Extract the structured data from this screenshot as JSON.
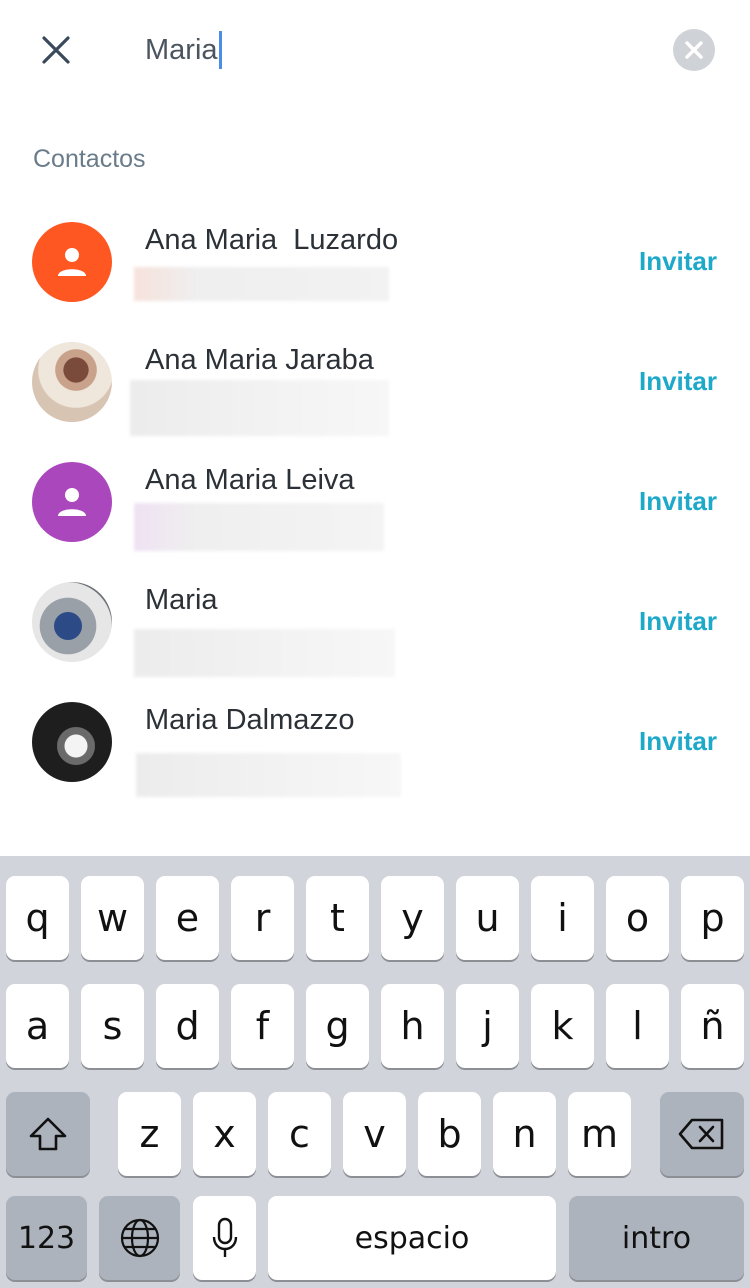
{
  "search": {
    "query": "Maria",
    "close_icon": "close-icon",
    "clear_icon": "clear-circle-icon"
  },
  "section_title": "Contactos",
  "contacts": [
    {
      "name": "Ana Maria  Luzardo",
      "avatar": "person-placeholder",
      "avatar_color": "#ff5722",
      "action": "Invitar"
    },
    {
      "name": "Ana Maria Jaraba",
      "avatar": "photo",
      "action": "Invitar"
    },
    {
      "name": "Ana Maria Leiva",
      "avatar": "person-placeholder",
      "avatar_color": "#ab47bc",
      "action": "Invitar"
    },
    {
      "name": "Maria",
      "avatar": "photo",
      "action": "Invitar"
    },
    {
      "name": "Maria Dalmazzo",
      "avatar": "photo",
      "action": "Invitar"
    }
  ],
  "keyboard": {
    "row1": [
      "q",
      "w",
      "e",
      "r",
      "t",
      "y",
      "u",
      "i",
      "o",
      "p"
    ],
    "row2": [
      "a",
      "s",
      "d",
      "f",
      "g",
      "h",
      "j",
      "k",
      "l",
      "ñ"
    ],
    "row3": [
      "z",
      "x",
      "c",
      "v",
      "b",
      "n",
      "m"
    ],
    "numbers_label": "123",
    "space_label": "espacio",
    "return_label": "intro",
    "shift_icon": "shift-icon",
    "delete_icon": "delete-icon",
    "globe_icon": "globe-icon",
    "mic_icon": "microphone-icon"
  },
  "colors": {
    "accent": "#1ea9c9",
    "section_title": "#6a7c8a"
  }
}
